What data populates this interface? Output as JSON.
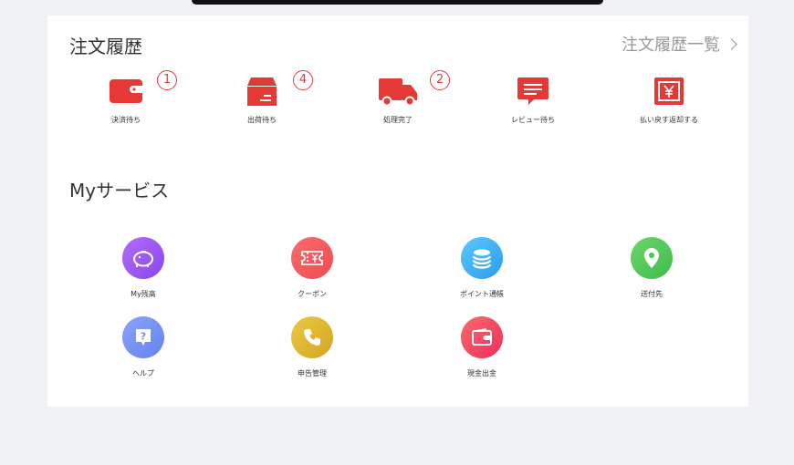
{
  "orders": {
    "title": "注文履歴",
    "view_all": "注文履歴一覧",
    "items": [
      {
        "label": "決済待ち",
        "badge": "1",
        "icon": "wallet-icon"
      },
      {
        "label": "出荷待ち",
        "badge": "4",
        "icon": "box-icon"
      },
      {
        "label": "処理完了",
        "badge": "2",
        "icon": "truck-icon"
      },
      {
        "label": "レビュー待ち",
        "icon": "comment-icon"
      },
      {
        "label": "払い戻す返却する",
        "icon": "refund-icon"
      }
    ]
  },
  "services": {
    "title": "Myサービス",
    "items": [
      {
        "label": "My残高",
        "icon": "piggy-bank-icon",
        "color": "#9b5cf2"
      },
      {
        "label": "クーポン",
        "icon": "coupon-icon",
        "color": "#f0575a"
      },
      {
        "label": "ポイント通帳",
        "icon": "coin-stack-icon",
        "color": "#3eaef5"
      },
      {
        "label": "送付先",
        "icon": "location-pin-icon",
        "color": "#4fc85a"
      },
      {
        "label": "ヘルプ",
        "icon": "help-icon",
        "color": "#6f8ef5"
      },
      {
        "label": "申告管理",
        "icon": "phone-icon",
        "color": "#e2b930"
      },
      {
        "label": "現金出金",
        "icon": "wallet-icon",
        "color": "#f04459"
      }
    ]
  },
  "colors": {
    "accent": "#e53935",
    "background": "#f0f1f5"
  }
}
